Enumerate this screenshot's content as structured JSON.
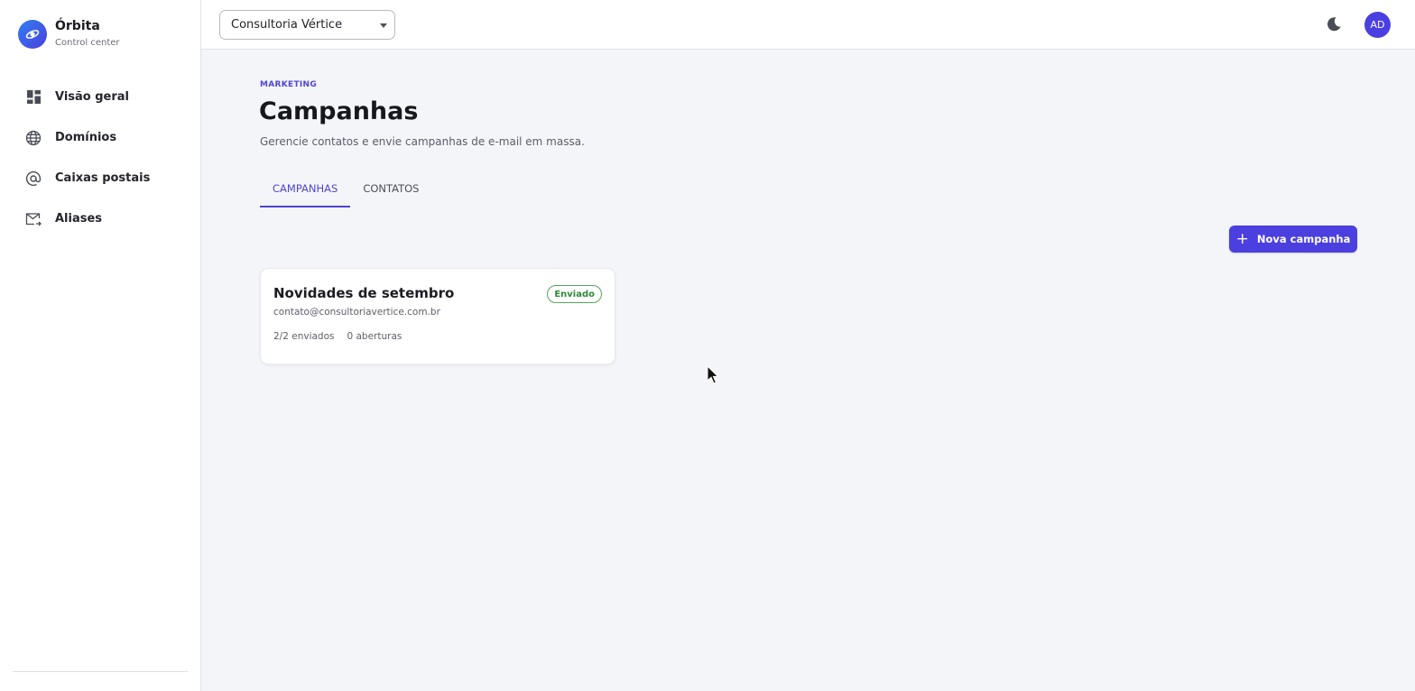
{
  "brand": {
    "name": "Órbita",
    "subtitle": "Control center",
    "logo_icon": "orbit-icon",
    "accent": "#4b3fe0"
  },
  "sidebar": {
    "items": [
      {
        "label": "Visão geral",
        "icon": "dashboard-icon"
      },
      {
        "label": "Domínios",
        "icon": "globe-icon"
      },
      {
        "label": "Caixas postais",
        "icon": "at-sign-icon"
      },
      {
        "label": "Aliases",
        "icon": "mail-forward-icon"
      }
    ]
  },
  "topbar": {
    "org_select_value": "Consultoria Vértice",
    "theme_toggle_icon": "moon-icon",
    "avatar_initials": "AD"
  },
  "page": {
    "eyebrow": "MARKETING",
    "title": "Campanhas",
    "subtitle": "Gerencie contatos e envie campanhas de e-mail em massa."
  },
  "tabs": [
    {
      "label": "CAMPANHAS",
      "active": true
    },
    {
      "label": "CONTATOS",
      "active": false
    }
  ],
  "actions": {
    "new_campaign_label": "Nova campanha"
  },
  "campaigns": [
    {
      "title": "Novidades de setembro",
      "status": "Enviado",
      "sender": "contato@consultoriavertice.com.br",
      "sent": "2/2 enviados",
      "opens": "0 aberturas"
    }
  ],
  "colors": {
    "primary": "#4b3fe0",
    "tab_active": "#4f45cf",
    "status_success": "#2f8a3a",
    "background": "#f4f5f9"
  }
}
